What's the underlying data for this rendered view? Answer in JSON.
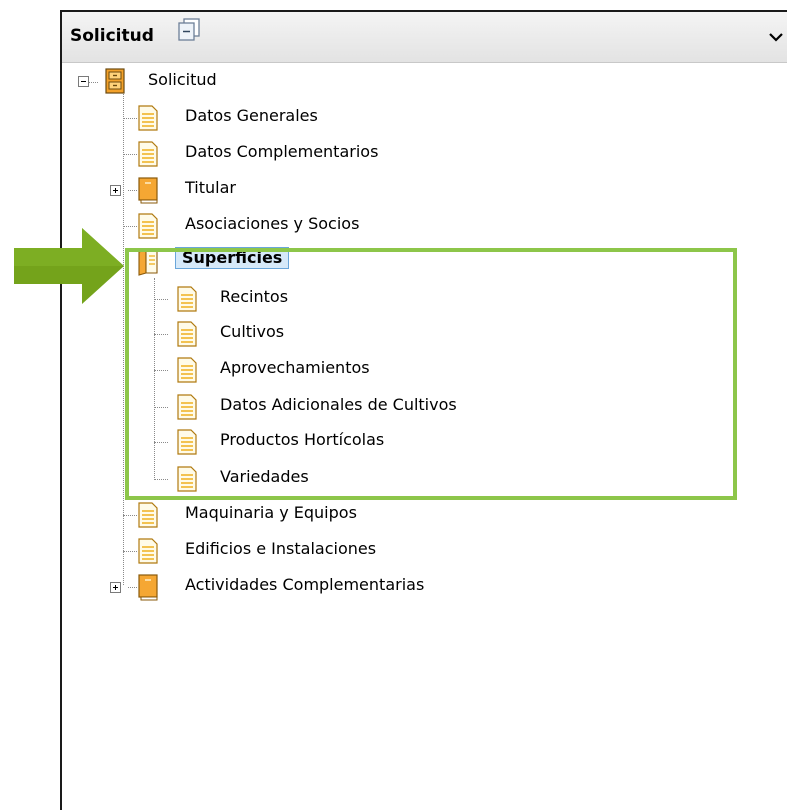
{
  "header": {
    "title": "Solicitud",
    "header_icon": "collapse-panel-icon",
    "chevron_icon": "chevron-down-icon"
  },
  "tree": {
    "root": {
      "label": "Solicitud",
      "icon": "cabinet-icon"
    },
    "items": [
      {
        "label": "Datos Generales",
        "icon": "document-icon"
      },
      {
        "label": "Datos Complementarios",
        "icon": "document-icon"
      },
      {
        "label": "Titular",
        "icon": "book-icon",
        "expandable": true
      },
      {
        "label": "Asociaciones y Socios",
        "icon": "document-icon"
      },
      {
        "label": "Superficies",
        "icon": "open-book-icon",
        "selected": true,
        "children": [
          {
            "label": "Recintos",
            "icon": "document-icon"
          },
          {
            "label": "Cultivos",
            "icon": "document-icon"
          },
          {
            "label": "Aprovechamientos",
            "icon": "document-icon"
          },
          {
            "label": "Datos Adicionales de Cultivos",
            "icon": "document-icon"
          },
          {
            "label": "Productos Hortícolas",
            "icon": "document-icon"
          },
          {
            "label": "Variedades",
            "icon": "document-icon"
          }
        ]
      },
      {
        "label": "Maquinaria y Equipos",
        "icon": "document-icon"
      },
      {
        "label": "Edificios e Instalaciones",
        "icon": "document-icon"
      },
      {
        "label": "Actividades Complementarias",
        "icon": "book-icon",
        "expandable": true
      }
    ]
  },
  "annotation": {
    "arrow_color": "#74a31b",
    "box_color": "#8dc64a",
    "selection_color": "#d6e9f9"
  }
}
